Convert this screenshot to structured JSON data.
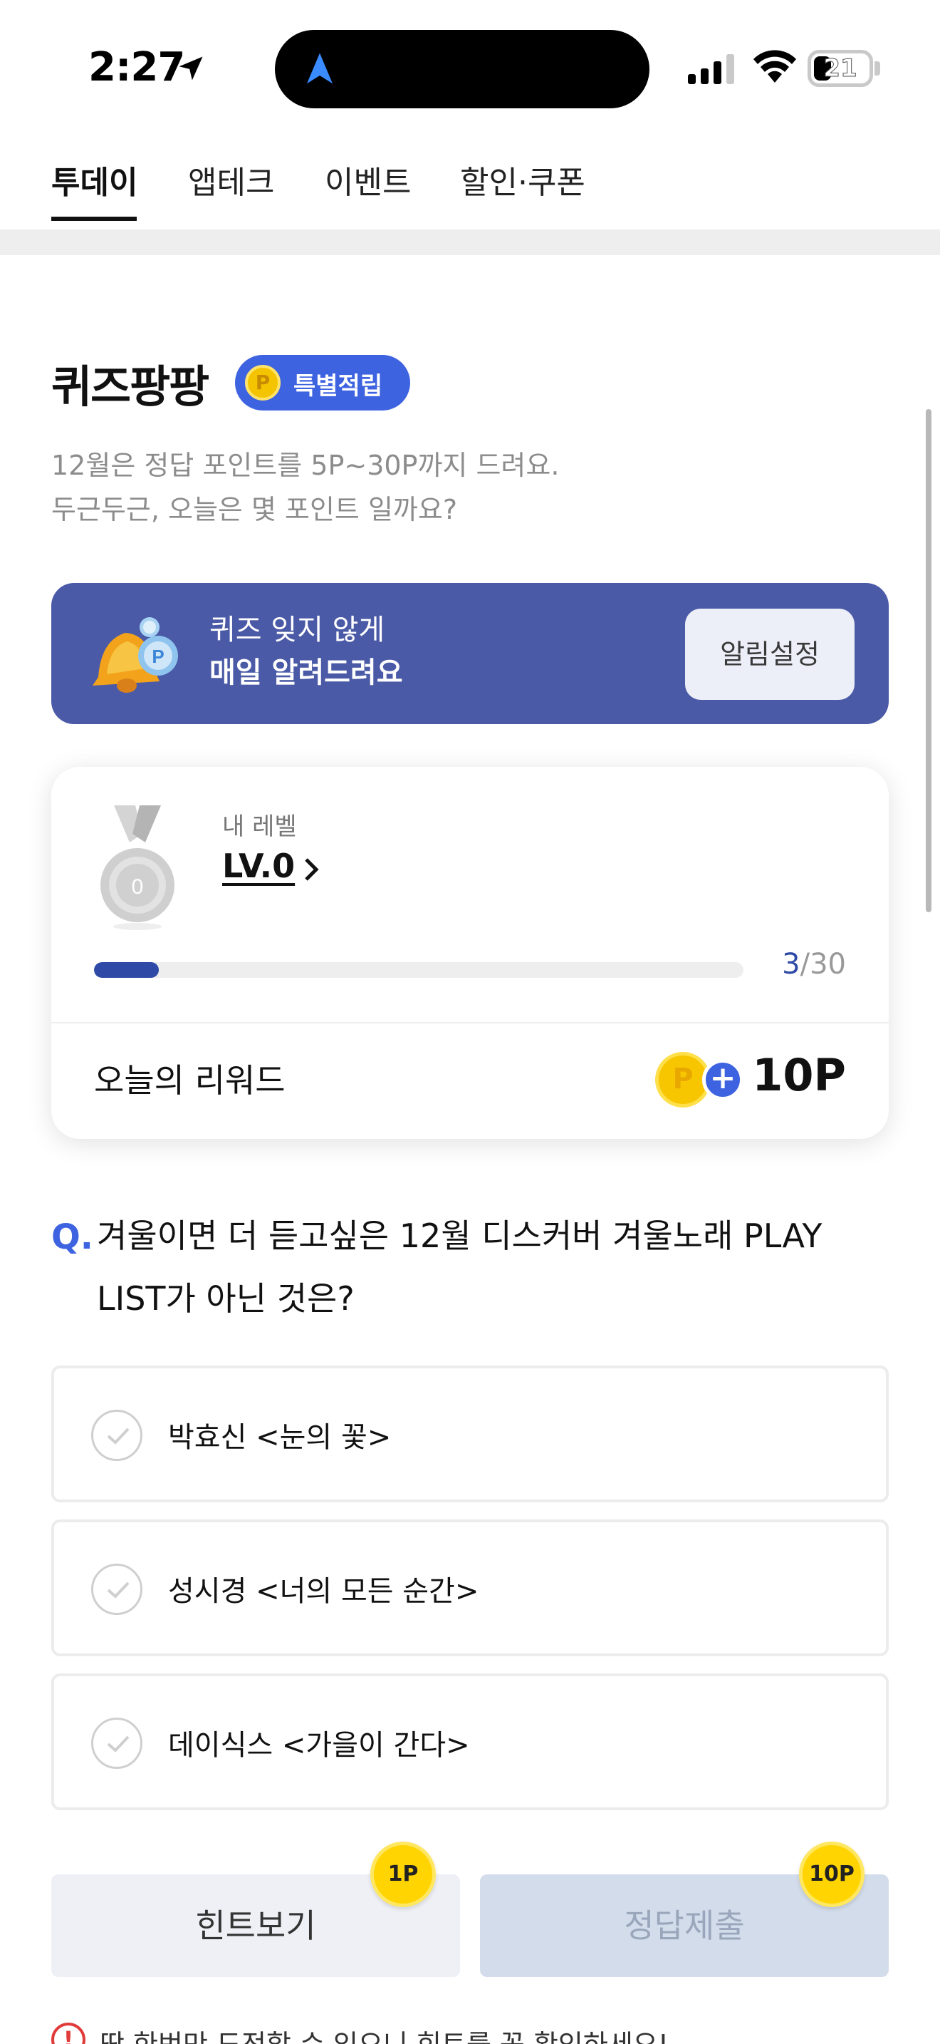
{
  "status_bar": {
    "time": "2:27",
    "battery": "21"
  },
  "tabs": [
    {
      "label": "투데이",
      "active": true
    },
    {
      "label": "앱테크",
      "active": false
    },
    {
      "label": "이벤트",
      "active": false
    },
    {
      "label": "할인·쿠폰",
      "active": false
    }
  ],
  "header": {
    "title": "퀴즈팡팡",
    "badge_icon": "P",
    "badge": "특별적립",
    "subtitle_line1": "12월은 정답 포인트를 5P~30P까지 드려요.",
    "subtitle_line2": "두근두근, 오늘은 몇 포인트 일까요?"
  },
  "notify_banner": {
    "line1": "퀴즈 잊지 않게",
    "line2": "매일 알려드려요",
    "button": "알림설정",
    "background_color": "#4a5aa6"
  },
  "level_card": {
    "medal_number": "0",
    "label": "내 레벨",
    "level": "LV.0",
    "progress_current": "3",
    "progress_separator": "/",
    "progress_total": "30",
    "progress_fraction": 0.1,
    "reward_label": "오늘의 리워드",
    "reward_coin_icon": "P",
    "reward_plus_icon": "+",
    "reward_points": "10P"
  },
  "question": {
    "prefix": "Q.",
    "text": "겨울이면 더 듣고싶은 12월 디스커버 겨울노래 PLAY LIST가 아닌 것은?"
  },
  "options": [
    {
      "label": "박효신 <눈의 꽃>"
    },
    {
      "label": "성시경 <너의 모든 순간>"
    },
    {
      "label": "데이식스 <가을이 간다>"
    }
  ],
  "actions": {
    "hint_button": "힌트보기",
    "hint_cost": "1P",
    "submit_button": "정답제출",
    "submit_cost": "10P",
    "warning_icon": "!",
    "warning": "딱 한번만 도전할 수 있으니 힌트를 꼭 확인하세요!"
  },
  "colors": {
    "accent": "#3e63e0",
    "progress": "#2e4aa6",
    "coin": "#ffd400"
  }
}
